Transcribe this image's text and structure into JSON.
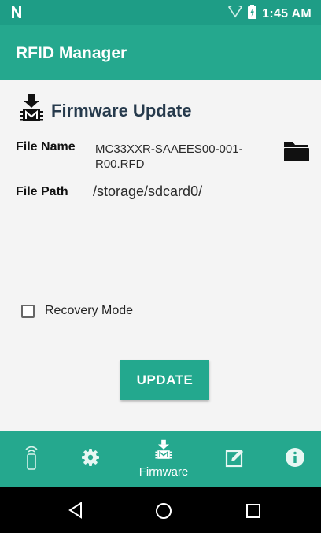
{
  "status_bar": {
    "time": "1:45 AM"
  },
  "app_bar": {
    "title": "RFID Manager"
  },
  "firmware": {
    "title": "Firmware Update",
    "file_name_label": "File Name",
    "file_name_value_line1": "MC33XXR-SAAEES00-001-",
    "file_name_value_line2": "R00.RFD",
    "file_path_label": "File Path",
    "file_path_value": "/storage/sdcard0/",
    "recovery_mode_label": "Recovery Mode",
    "recovery_mode_checked": false,
    "update_label": "UPDATE"
  },
  "bottom_nav": {
    "items": [
      {
        "icon": "rfid-reader-icon",
        "label": ""
      },
      {
        "icon": "gear-icon",
        "label": ""
      },
      {
        "icon": "firmware-chip-icon",
        "label": "Firmware",
        "active": true
      },
      {
        "icon": "edit-icon",
        "label": ""
      },
      {
        "icon": "info-icon",
        "label": ""
      }
    ]
  },
  "system_nav": {
    "back": "back-icon",
    "home": "home-icon",
    "recents": "recents-icon"
  },
  "colors": {
    "primary": "#25a88e",
    "status_bar": "#1e9d86",
    "title_text": "#263a4c"
  }
}
